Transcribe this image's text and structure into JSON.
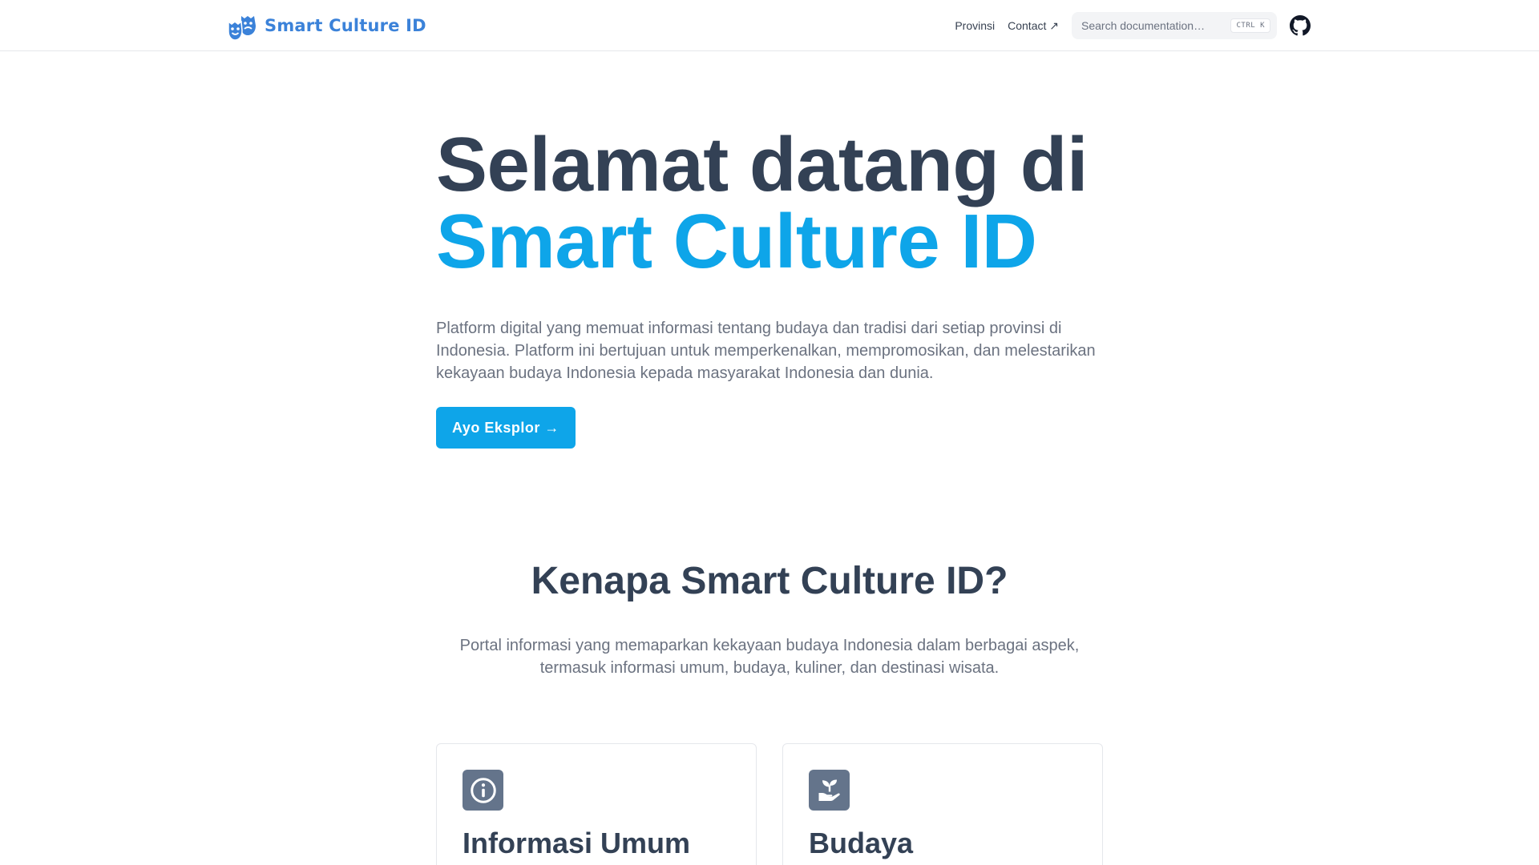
{
  "navbar": {
    "brand": "Smart Culture ID",
    "links": [
      {
        "label": "Provinsi"
      },
      {
        "label": "Contact ↗"
      }
    ],
    "search": {
      "placeholder": "Search documentation…",
      "shortcut": "CTRL K"
    },
    "icons": {
      "logo": "theater-masks-icon",
      "github": "github-icon"
    }
  },
  "hero": {
    "title_line1": "Selamat datang di",
    "title_line2": "Smart Culture ID",
    "description": "Platform digital yang memuat informasi tentang budaya dan tradisi dari setiap provinsi di Indonesia. Platform ini bertujuan untuk memperkenalkan, mempromosikan, dan melestarikan kekayaan budaya Indonesia kepada masyarakat Indonesia dan dunia.",
    "cta_label": "Ayo Eksplor →"
  },
  "why": {
    "title": "Kenapa Smart Culture ID?",
    "description": "Portal informasi yang memaparkan kekayaan budaya Indonesia dalam berbagai aspek, termasuk informasi umum, budaya, kuliner, dan destinasi wisata."
  },
  "cards": [
    {
      "title": "Informasi Umum",
      "icon": "info-icon"
    },
    {
      "title": "Budaya",
      "icon": "hand-sprout-icon"
    }
  ],
  "colors": {
    "accent": "#0ea5e9",
    "brand": "#3b82d9",
    "heading": "#334155",
    "muted": "#6b7280",
    "icon_bg": "#64748b"
  }
}
